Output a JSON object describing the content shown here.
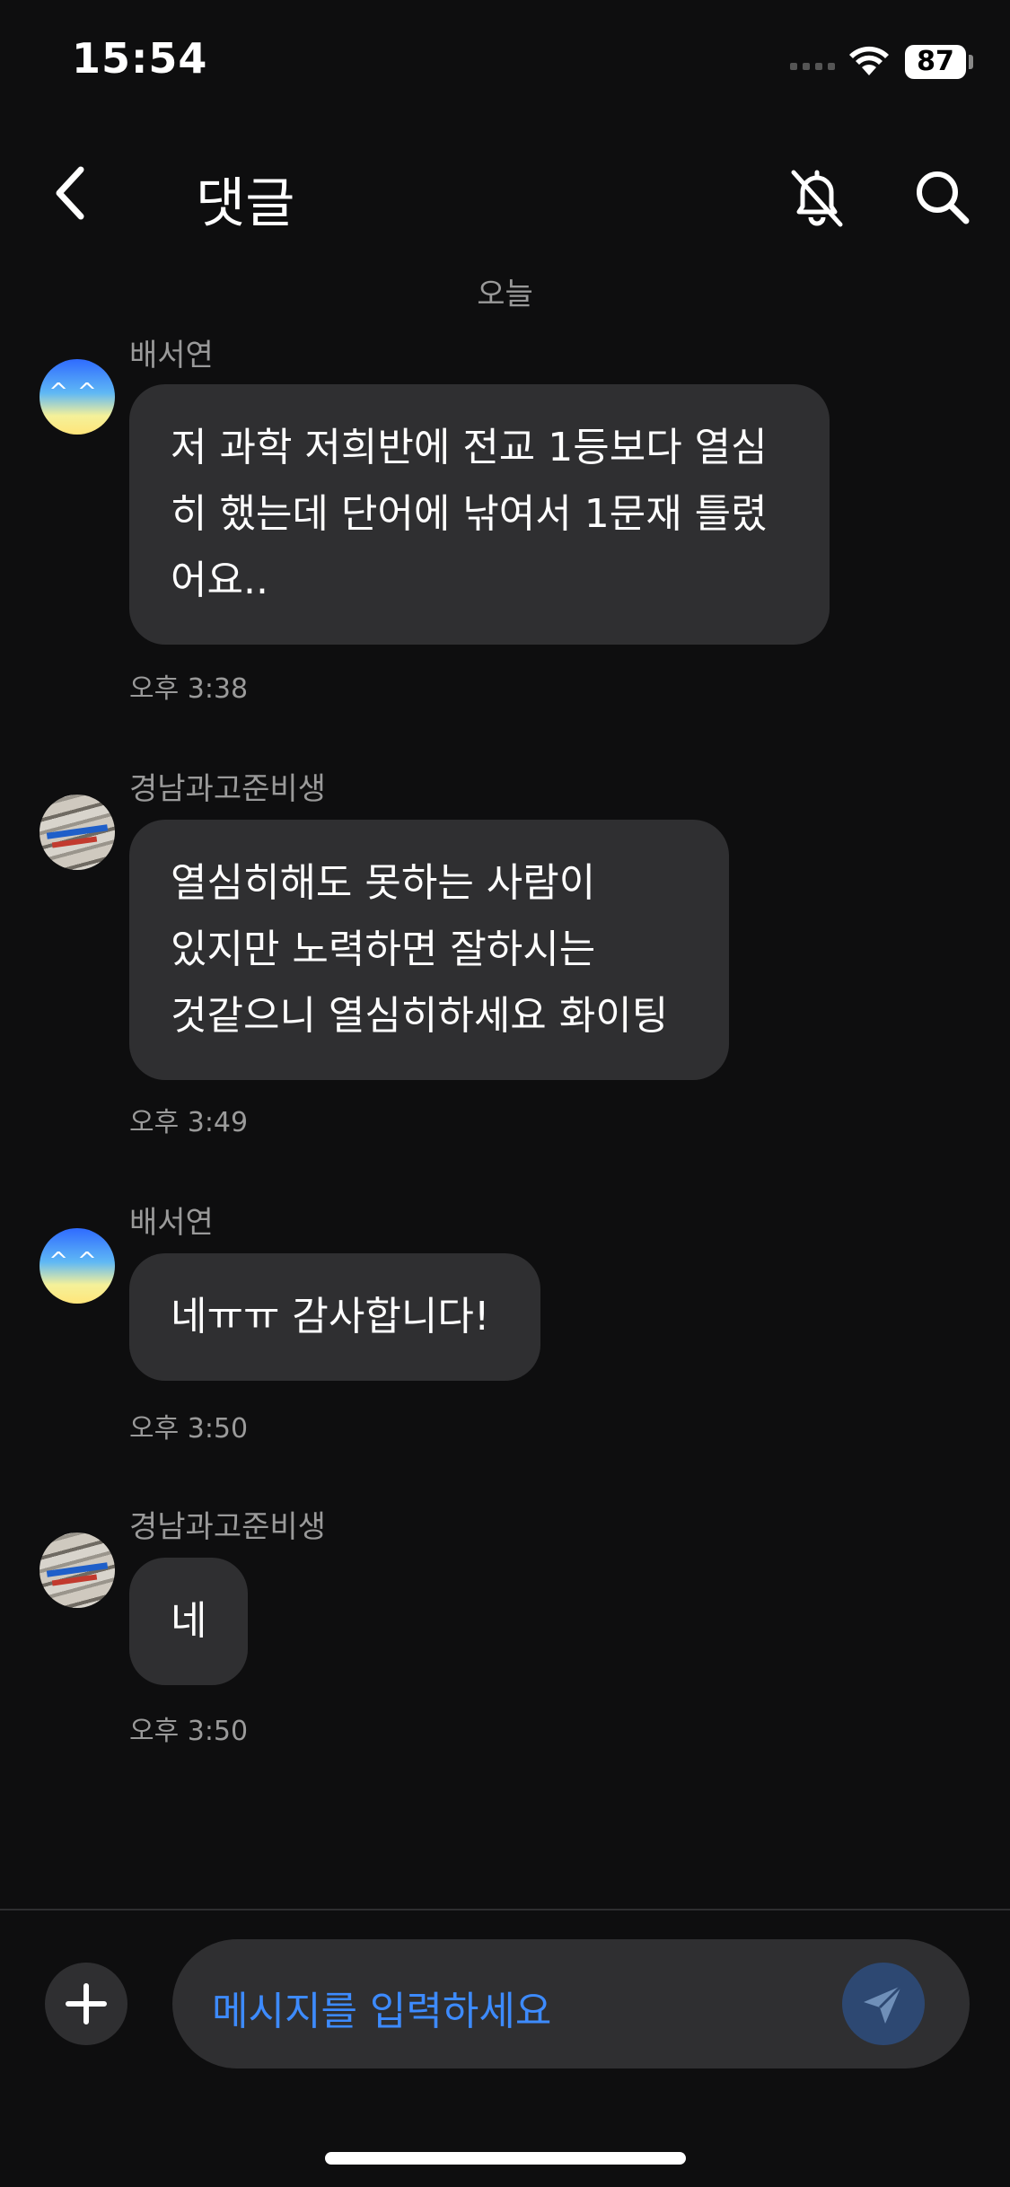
{
  "status_bar": {
    "time": "15:54",
    "battery": "87"
  },
  "header": {
    "title": "댓글"
  },
  "date_separator": "오늘",
  "messages": [
    {
      "sender": "배서연",
      "avatar": "sky-smile-avatar",
      "lines": [
        "저 과학 저희반에 전교 1등보다 열심",
        "히 했는데 단어에 낚여서 1문재 틀렸",
        "어요.."
      ],
      "time": "오후 3:38"
    },
    {
      "sender": "경남과고준비생",
      "avatar": "photo-avatar",
      "lines": [
        "열심히해도 못하는 사람이",
        "있지만 노력하면 잘하시는",
        "것같으니 열심히하세요 화이팅"
      ],
      "time": "오후 3:49"
    },
    {
      "sender": "배서연",
      "avatar": "sky-smile-avatar",
      "lines": [
        "네ㅠㅠ 감사합니다!"
      ],
      "time": "오후 3:50"
    },
    {
      "sender": "경남과고준비생",
      "avatar": "photo-avatar",
      "lines": [
        "네"
      ],
      "time": "오후 3:50"
    }
  ],
  "composer": {
    "placeholder": "메시지를 입력하세요"
  },
  "icons": {
    "back": "chevron-left-icon",
    "bell": "bell-off-icon",
    "search": "search-icon",
    "plus": "plus-icon",
    "send": "send-icon"
  },
  "colors": {
    "background": "#0e0e0f",
    "bubble": "#2f2f31",
    "accent": "#3d8bff"
  }
}
